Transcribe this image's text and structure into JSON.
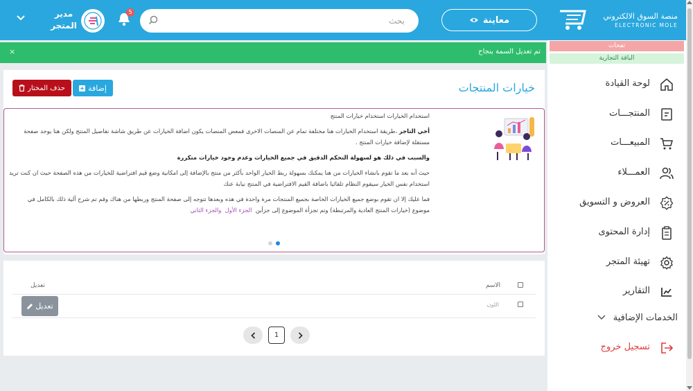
{
  "header": {
    "logo_line1": "منصة السوق الالكتروني",
    "logo_line2": "ELECTRONIC MOLE",
    "preview_label": "معاينة",
    "search_placeholder": "بحث",
    "notifications_count": "5",
    "manager_line1": "مدير",
    "manager_line2": "المتجر",
    "colors": {
      "primary": "#29a7de",
      "success": "#2ebd6c",
      "danger": "#b8101a"
    }
  },
  "alert": {
    "message": "تم تعديل السمة بنجاح",
    "close": "×"
  },
  "sidebar": {
    "plan_red": "تفحات",
    "plan_green": "الباقة التجارية",
    "items": [
      {
        "label": "لوحة القيادة",
        "icon": "home-icon"
      },
      {
        "label": "المنتجـــات",
        "icon": "box-icon"
      },
      {
        "label": "المبيعـــات",
        "icon": "cart-icon"
      },
      {
        "label": "العمـــلاء",
        "icon": "users-icon"
      },
      {
        "label": "العروض و التسويق",
        "icon": "percent-badge-icon"
      },
      {
        "label": "إدارة المحتوى",
        "icon": "clipboard-icon"
      },
      {
        "label": "تهيئة المتجر",
        "icon": "gear-icon"
      },
      {
        "label": "التقارير",
        "icon": "chart-icon"
      },
      {
        "label": "الخدمات الإضافية",
        "icon": "chevron-down-icon"
      },
      {
        "label": "تسجيل خروج",
        "icon": "logout-icon"
      }
    ]
  },
  "main": {
    "title": "خيارات المنتجات",
    "add_label": "إضافة",
    "delete_label": "حذف المختار",
    "info": {
      "heading": "استخدام الخيارات استخدام خيارات المنتج",
      "p1_lead": "أخي التاجر",
      "p1_text": "،طريقة استخدام الخيارات هنا مختلفة تمام عن المنصات الاخرى فمعض المنصات يكون اضافة الخيارات عن طريق شاشة تفاصيل المنتج ولكن هنا يوجد صفحة مستقلة لإضافة خيارات المنتج .",
      "p2_bold": "والسبب في ذلك هو لسهولة التحكم الدقيق في جميع الخيارات وعدم وجود خيارات متكررة",
      "p3": "حيث أنه بعد ما تقوم بانشاء الخيارات من هنا يمكنك بسهولة ربط الخيار الواحد بأكثر من منتج بالإضافة إلى امكانية وضع قيم افتراضية للخيارات من هذه الصفحة حيث ان كنت تريد استخدام نفس الخيار سيقوم النظام تلقائيا باضافة القيم الافتراضية في المنتج نيابة عنك",
      "p4": "فما عليك إلا ان تقوم بوضع جميع الخيارات الخاصة بجميع المنتجات مرة واحدة في هذه وبعدها تتوجه إلى صفحة المنتج وربطها من هناك وقم تم شرح آلية ذلك بالكامل في موضوع (خيارات المنتج العادية والمرتبطة) وتم تجزأة الموضوع إلى جزأين",
      "link1": "الجزء الأول",
      "link_and": "و",
      "link2": "الجزء الثاني"
    },
    "table": {
      "col_name": "الاسم",
      "col_edit": "تعديل",
      "rows": [
        {
          "name": "اللون",
          "edit_label": "تعديل"
        }
      ]
    },
    "pagination": {
      "prev": "‹",
      "current": "1",
      "next": "›"
    }
  }
}
